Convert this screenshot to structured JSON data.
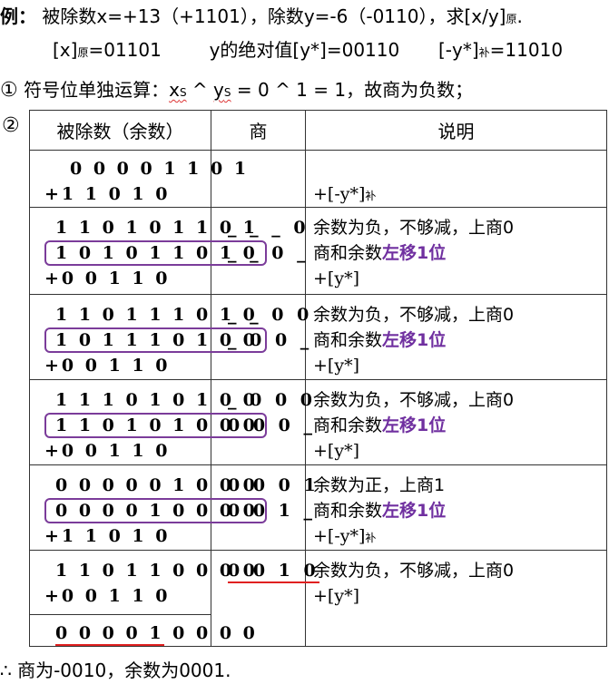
{
  "header": {
    "example_label": "例：",
    "problem": "被除数x=+13（+1101），除数y=-6（-0110），求[x/y]",
    "problem_sub": "原",
    "problem_end": ".",
    "x_orig": "[x]",
    "x_orig_sub": "原",
    "x_orig_val": "=01101",
    "y_abs": "y的绝对值[y*]=00110",
    "neg_y": "[-y*]",
    "neg_y_sub": "补",
    "neg_y_val": "=11010"
  },
  "step1": {
    "marker": "①",
    "text_a": "符号位单独运算：",
    "xs": "x",
    "xs_sub": "S",
    "op": " ^ ",
    "ys": "y",
    "ys_sub": "S",
    "text_b": " = 0 ^ 1 = 1，故商为负数；"
  },
  "step2": {
    "marker": "②"
  },
  "table": {
    "headers": [
      "被除数（余数）",
      "商",
      "说明"
    ],
    "r0": {
      "a": "0 0 0 0 1 1 0 1",
      "b": "+1 1 0 1 0",
      "d": "+[-y*]",
      "d_sub": "补"
    },
    "r1": {
      "a": "1 1 0 1 0 1 1 0 1",
      "b": "1 0 1 0 1 1 0 1 0",
      "c": "+0 0 1 1 0",
      "q1": "_ _ _ 0",
      "q2": "_ _ 0 _",
      "d1": "余数为负，不够减，上商0",
      "d2a": "商和余数",
      "d2b": "左移1位",
      "d3": "+[y*]"
    },
    "r2": {
      "a": "1 1 0 1 1 1 0 1 0",
      "b": "1 0 1 1 1 0 1 0 0",
      "c": "+0 0 1 1 0",
      "q1": "_ _ 0 0",
      "q2": "_ 0 0 _",
      "d1": "余数为负，不够减，上商0",
      "d2a": "商和余数",
      "d2b": "左移1位",
      "d3": "+[y*]"
    },
    "r3": {
      "a": "1 1 1 0 1 0 1 0 0",
      "b": "1 1 0 1 0 1 0 0 0",
      "c": "+0 0 1 1 0",
      "q1": "_ 0 0 0",
      "q2": "0 0 0 _",
      "d1": "余数为负，不够减，上商0",
      "d2a": "商和余数",
      "d2b": "左移1位",
      "d3": "+[y*]"
    },
    "r4": {
      "a": "0 0 0 0 0 1 0 0 0",
      "b": "0 0 0 0 1 0 0 0 0",
      "c": "+1 1 0 1 0",
      "q1": "0 0 0 1",
      "q2": "0 0 1 _",
      "d1": "余数为正，上商1",
      "d2a": "商和余数",
      "d2b": "左移1位",
      "d3": "+[-y*]",
      "d3_sub": "补"
    },
    "r5": {
      "a": "1 1 0 1 1 0 0 0 0",
      "b": "+0 0 1 1 0",
      "c_red": "0 0 0 0 1",
      "c_rest": " 0 0 0 0",
      "q1": "0 0 1 0",
      "d1": "余数为负，不够减，上商0",
      "d3": "+[y*]"
    }
  },
  "conclusion": "∴ 商为-0010，余数为0001."
}
